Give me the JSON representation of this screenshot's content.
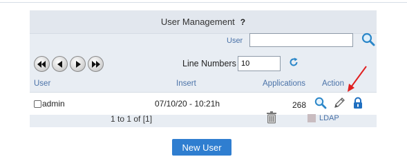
{
  "panel": {
    "title": "User Management",
    "help": "?"
  },
  "search": {
    "label": "User",
    "value": "",
    "button_icon": "magnifier-icon"
  },
  "pagination_nav": {
    "buttons": [
      "rewind-first-icon",
      "previous-icon",
      "next-icon",
      "fast-forward-last-icon"
    ]
  },
  "line_numbers": {
    "label": "Line Numbers",
    "value": "10",
    "refresh_icon": "refresh-icon"
  },
  "table": {
    "headers": [
      "User",
      "Insert",
      "Applications",
      "Action"
    ],
    "rows": [
      {
        "user": "admin",
        "insert": "07/10/20  -  10:21h",
        "applications": "268",
        "actions": [
          "view-icon",
          "edit-pencil-icon",
          "lock-icon"
        ]
      }
    ]
  },
  "footer": {
    "pager": "1  to  1   of  [1]",
    "trash_icon": "trash-icon",
    "ldap_label": "LDAP"
  },
  "new_user_button": "New User",
  "colors": {
    "panel_bg": "#e8edf3",
    "header_text": "#4a72a8",
    "primary_button": "#2f7ed0",
    "annotation_arrow": "#e02020"
  }
}
